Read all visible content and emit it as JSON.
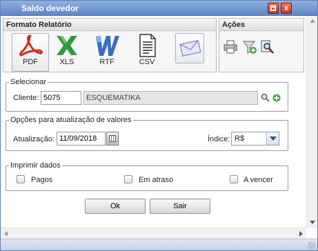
{
  "window": {
    "title": "Saldo devedor"
  },
  "formato": {
    "header": "Formato Relatório",
    "items": [
      {
        "label": "PDF",
        "icon": "pdf-icon",
        "color": "#d8261c"
      },
      {
        "label": "XLS",
        "icon": "xls-icon",
        "color": "#2f9a3c"
      },
      {
        "label": "RTF",
        "icon": "rtf-icon",
        "color": "#3a6bc8"
      },
      {
        "label": "CSV",
        "icon": "csv-icon",
        "color": "#333333"
      },
      {
        "label": "",
        "icon": "envelope-icon",
        "color": "#8d8fc9"
      }
    ]
  },
  "acoes": {
    "header": "Ações",
    "icons": [
      "printer-icon",
      "filter-add-icon",
      "search-report-icon"
    ]
  },
  "selecionar": {
    "legend": "Selecionar",
    "cliente_label": "Cliente:",
    "cliente_code": "5075",
    "cliente_name": "ESQUEMATIKA"
  },
  "opcoes": {
    "legend": "Opções para atualização de valores",
    "atualizacao_label": "Atualização:",
    "atualizacao_value": "11/09/2018",
    "indice_label": "Índice:",
    "indice_value": "R$"
  },
  "imprimir": {
    "legend": "Imprimir dados",
    "options": [
      {
        "label": "Pagos",
        "checked": false
      },
      {
        "label": "Em atraso",
        "checked": false
      },
      {
        "label": "A vencer",
        "checked": false
      }
    ]
  },
  "buttons": {
    "ok": "Ok",
    "sair": "Sair"
  },
  "colors": {
    "titlebar": "#6f93cf",
    "accent": "#2e4f80"
  }
}
